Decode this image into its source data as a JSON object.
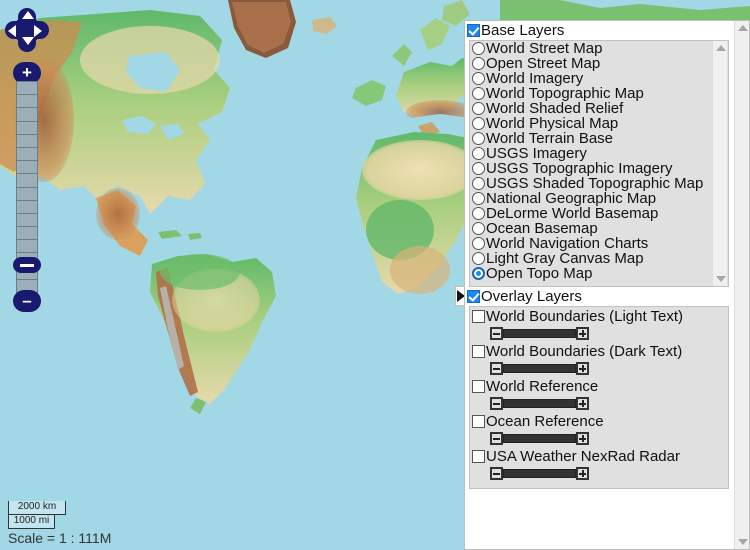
{
  "map": {
    "name": "world-physical-relief-map",
    "ocean_color": "#a2d8e6",
    "nav": {
      "pan_up_label": "Pan north",
      "pan_down_label": "Pan south",
      "pan_left_label": "Pan west",
      "pan_right_label": "Pan east",
      "zoom_in_label": "+",
      "zoom_out_label": "–"
    },
    "scale": {
      "km_label": "2000 km",
      "mi_label": "1000 mi",
      "scale_text": "Scale = 1 : 111M"
    }
  },
  "panel": {
    "toggle_label": "▶",
    "base": {
      "header_label": "Base Layers",
      "checked": true,
      "selected": "Open Topo Map",
      "items": [
        {
          "label": "World Street Map",
          "selected": false
        },
        {
          "label": "Open Street Map",
          "selected": false
        },
        {
          "label": "World Imagery",
          "selected": false
        },
        {
          "label": "World Topographic Map",
          "selected": false
        },
        {
          "label": "World Shaded Relief",
          "selected": false
        },
        {
          "label": "World Physical Map",
          "selected": false
        },
        {
          "label": "World Terrain Base",
          "selected": false
        },
        {
          "label": "USGS Imagery",
          "selected": false
        },
        {
          "label": "USGS Topographic Imagery",
          "selected": false
        },
        {
          "label": "USGS Shaded Topographic Map",
          "selected": false
        },
        {
          "label": "National Geographic Map",
          "selected": false
        },
        {
          "label": "DeLorme World Basemap",
          "selected": false
        },
        {
          "label": "Ocean Basemap",
          "selected": false
        },
        {
          "label": "World Navigation Charts",
          "selected": false
        },
        {
          "label": "Light Gray Canvas Map",
          "selected": false
        },
        {
          "label": "Open Topo Map",
          "selected": true
        }
      ]
    },
    "overlay": {
      "header_label": "Overlay Layers",
      "checked": true,
      "items": [
        {
          "label": "World Boundaries (Light Text)",
          "checked": false,
          "opacity": 100
        },
        {
          "label": "World Boundaries (Dark Text)",
          "checked": false,
          "opacity": 100
        },
        {
          "label": "World Reference",
          "checked": false,
          "opacity": 100
        },
        {
          "label": "Ocean Reference",
          "checked": false,
          "opacity": 100
        },
        {
          "label": "USA Weather NexRad Radar",
          "checked": false,
          "opacity": 100
        }
      ],
      "slider": {
        "minus_label": "−",
        "plus_label": "+"
      }
    }
  }
}
